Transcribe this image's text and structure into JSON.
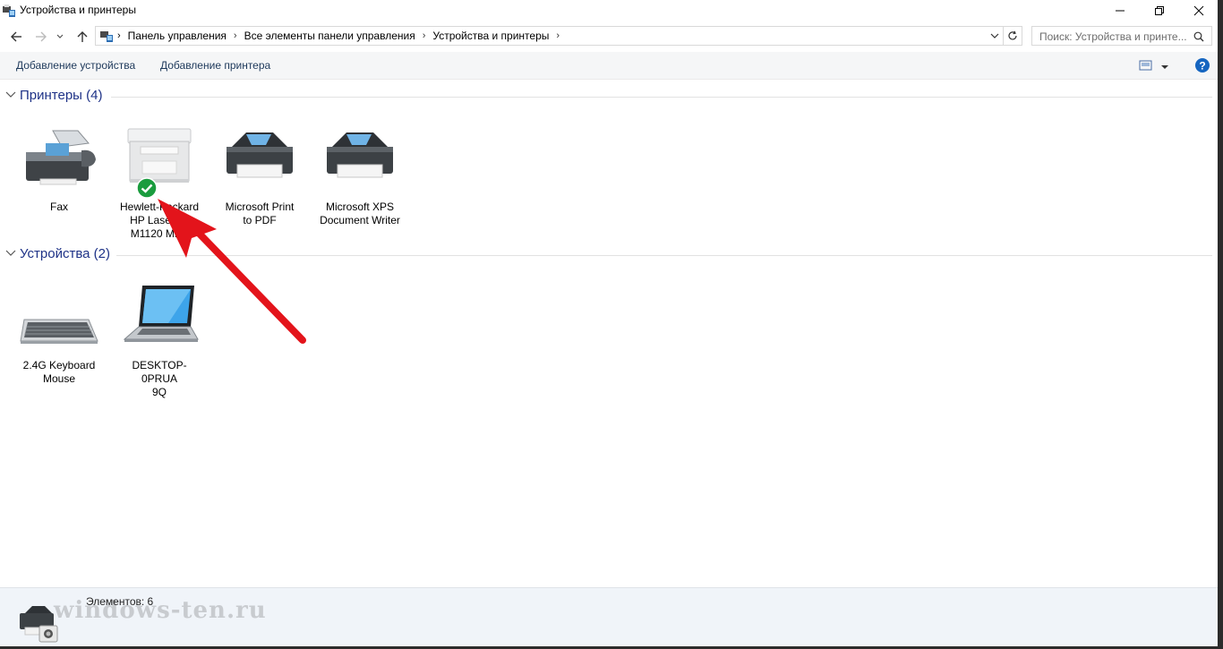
{
  "window": {
    "title": "Устройства и принтеры"
  },
  "address": {
    "crumbs": [
      "Панель управления",
      "Все элементы панели управления",
      "Устройства и принтеры"
    ],
    "search_placeholder": "Поиск: Устройства и принте..."
  },
  "toolbar": {
    "add_device": "Добавление устройства",
    "add_printer": "Добавление принтера"
  },
  "groups": {
    "printers": {
      "title": "Принтеры (4)",
      "items": [
        {
          "line1": "Fax",
          "line2": "",
          "line3": ""
        },
        {
          "line1": "Hewlett-Packard",
          "line2": "HP LaserJet",
          "line3": "M1120 MFP",
          "default": true
        },
        {
          "line1": "Microsoft Print",
          "line2": "to PDF",
          "line3": ""
        },
        {
          "line1": "Microsoft XPS",
          "line2": "Document Writer",
          "line3": ""
        }
      ]
    },
    "devices": {
      "title": "Устройства (2)",
      "items": [
        {
          "line1": "2.4G Keyboard",
          "line2": "Mouse"
        },
        {
          "line1": "DESKTOP-0PRUA",
          "line2": "9Q"
        }
      ]
    }
  },
  "status": {
    "count": "Элементов: 6",
    "watermark": "windows-ten.ru"
  },
  "colors": {
    "accent": "#1e3287",
    "arrow": "#e3141b",
    "default_badge": "#1a9c3e"
  }
}
